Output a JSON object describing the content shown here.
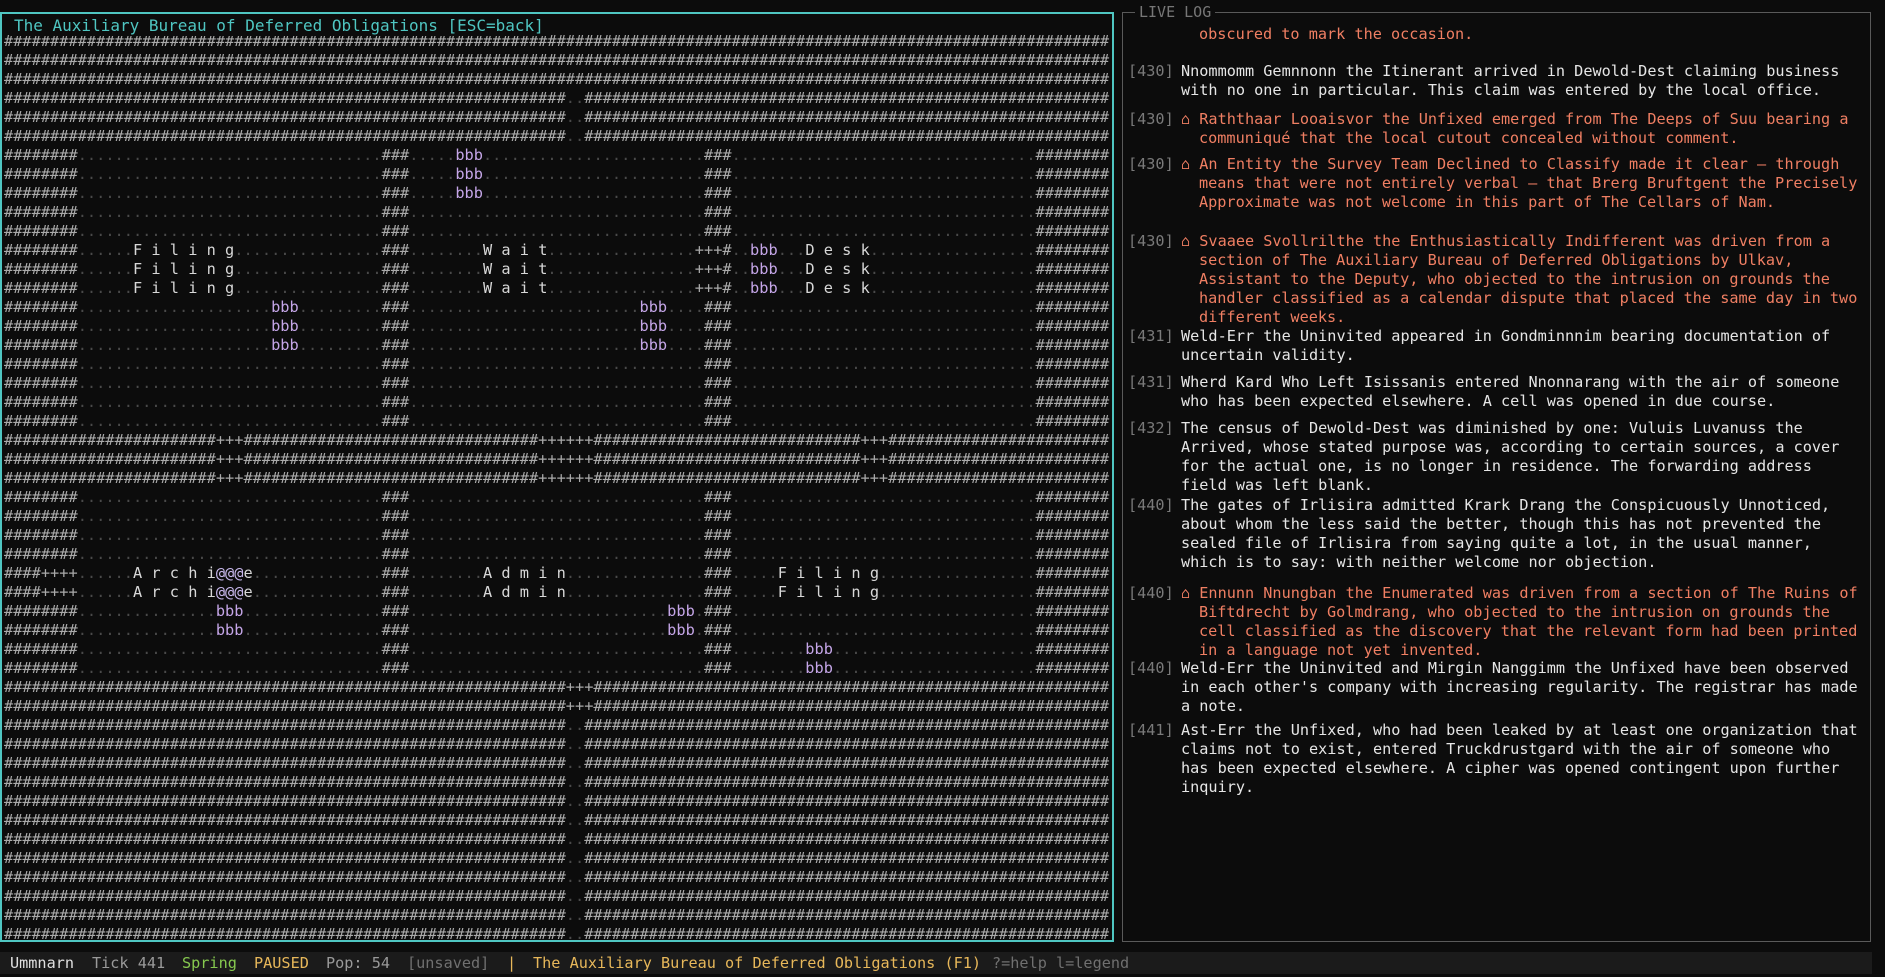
{
  "map": {
    "title": "The Auxiliary Bureau of Deferred Obligations [ESC=back]",
    "rooms": [
      {
        "label": "Filing"
      },
      {
        "label": "Wait"
      },
      {
        "label": "Desk"
      },
      {
        "label": "Archive"
      },
      {
        "label": "Admin"
      },
      {
        "label": "Filing"
      }
    ]
  },
  "log": {
    "title": "LIVE LOG",
    "entries": [
      {
        "tick": "",
        "text": "obscured to mark the occasion.",
        "alert": true,
        "continuation": true
      },
      {
        "tick": "[430]",
        "text": "Nnommomm Gemnnonn the Itinerant arrived in Dewold-Dest claiming business with no one in particular. This claim was entered by the local office.",
        "alert": false
      },
      {
        "tick": "[430]",
        "text": "⌂ Raththaar Looaisvor the Unfixed emerged from The Deeps of Suu bearing a communiqué that the local cutout concealed without comment.",
        "alert": true
      },
      {
        "tick": "[430]",
        "text": "⌂ An Entity the Survey Team Declined to Classify made it clear — through means that were not entirely verbal — that Brerg Bruftgent the Precisely Approximate was not welcome in this part of The Cellars of Nam.",
        "alert": true
      },
      {
        "tick": "[430]",
        "text": "⌂ Svaaee Svollrilthe the Enthusiastically Indifferent was driven from a section of The Auxiliary Bureau of Deferred Obligations by Ulkav, Assistant to the Deputy, who objected to the intrusion on grounds the handler classified as a calendar dispute that placed the same day in two different weeks.",
        "alert": true
      },
      {
        "tick": "[431]",
        "text": "Weld-Err the Uninvited appeared in Gondminnnim bearing documentation of uncertain validity.",
        "alert": false
      },
      {
        "tick": "[431]",
        "text": "Wherd Kard Who Left Isissanis entered Nnonnarang with the air of someone who has been expected elsewhere. A cell was opened in due course.",
        "alert": false
      },
      {
        "tick": "[432]",
        "text": "The census of Dewold-Dest was diminished by one: Vuluis Luvanuss the Arrived, whose stated purpose was, according to certain sources, a cover for the actual one, is no longer in residence. The forwarding address field was left blank.",
        "alert": false
      },
      {
        "tick": "[440]",
        "text": "The gates of Irlisira admitted Krark Drang the Conspicuously Unnoticed, about whom the less said the better, though this has not prevented the sealed file of Irlisira from saying quite a lot, in the usual manner, which is to say: with neither welcome nor objection.",
        "alert": false
      },
      {
        "tick": "[440]",
        "text": "⌂ Ennunn Nnungban the Enumerated was driven from a section of The Ruins of Biftdrecht by Golmdrang, who objected to the intrusion on grounds the cell classified as the discovery that the relevant form had been printed in a language not yet invented.",
        "alert": true
      },
      {
        "tick": "[440]",
        "text": "Weld-Err the Uninvited and Mirgin Nanggimm the Unfixed have been observed in each other's company with increasing regularity. The registrar has made a note.",
        "alert": false
      },
      {
        "tick": "[441]",
        "text": "Ast-Err the Unfixed, who had been leaked by at least one organization that claims not to exist, entered Truckdrustgard with the air of someone who has been expected elsewhere. A cipher was opened contingent upon further inquiry.",
        "alert": false
      }
    ]
  },
  "status": {
    "world": "Ummnarn",
    "tick": "Tick 441",
    "season": "Spring",
    "state": "PAUSED",
    "pop": "Pop: 54",
    "save": "[unsaved]",
    "sep": "|",
    "location": "The Auxiliary Bureau of Deferred Obligations (F1)",
    "help": "?=help l=legend",
    "colors": {
      "world": "#e0e0e0",
      "tick": "#9a9a9a",
      "season": "#86c94f",
      "state": "#e8b85a",
      "pop": "#9a9a9a",
      "save": "#707070",
      "location": "#e8b85a",
      "help": "#707070"
    }
  }
}
